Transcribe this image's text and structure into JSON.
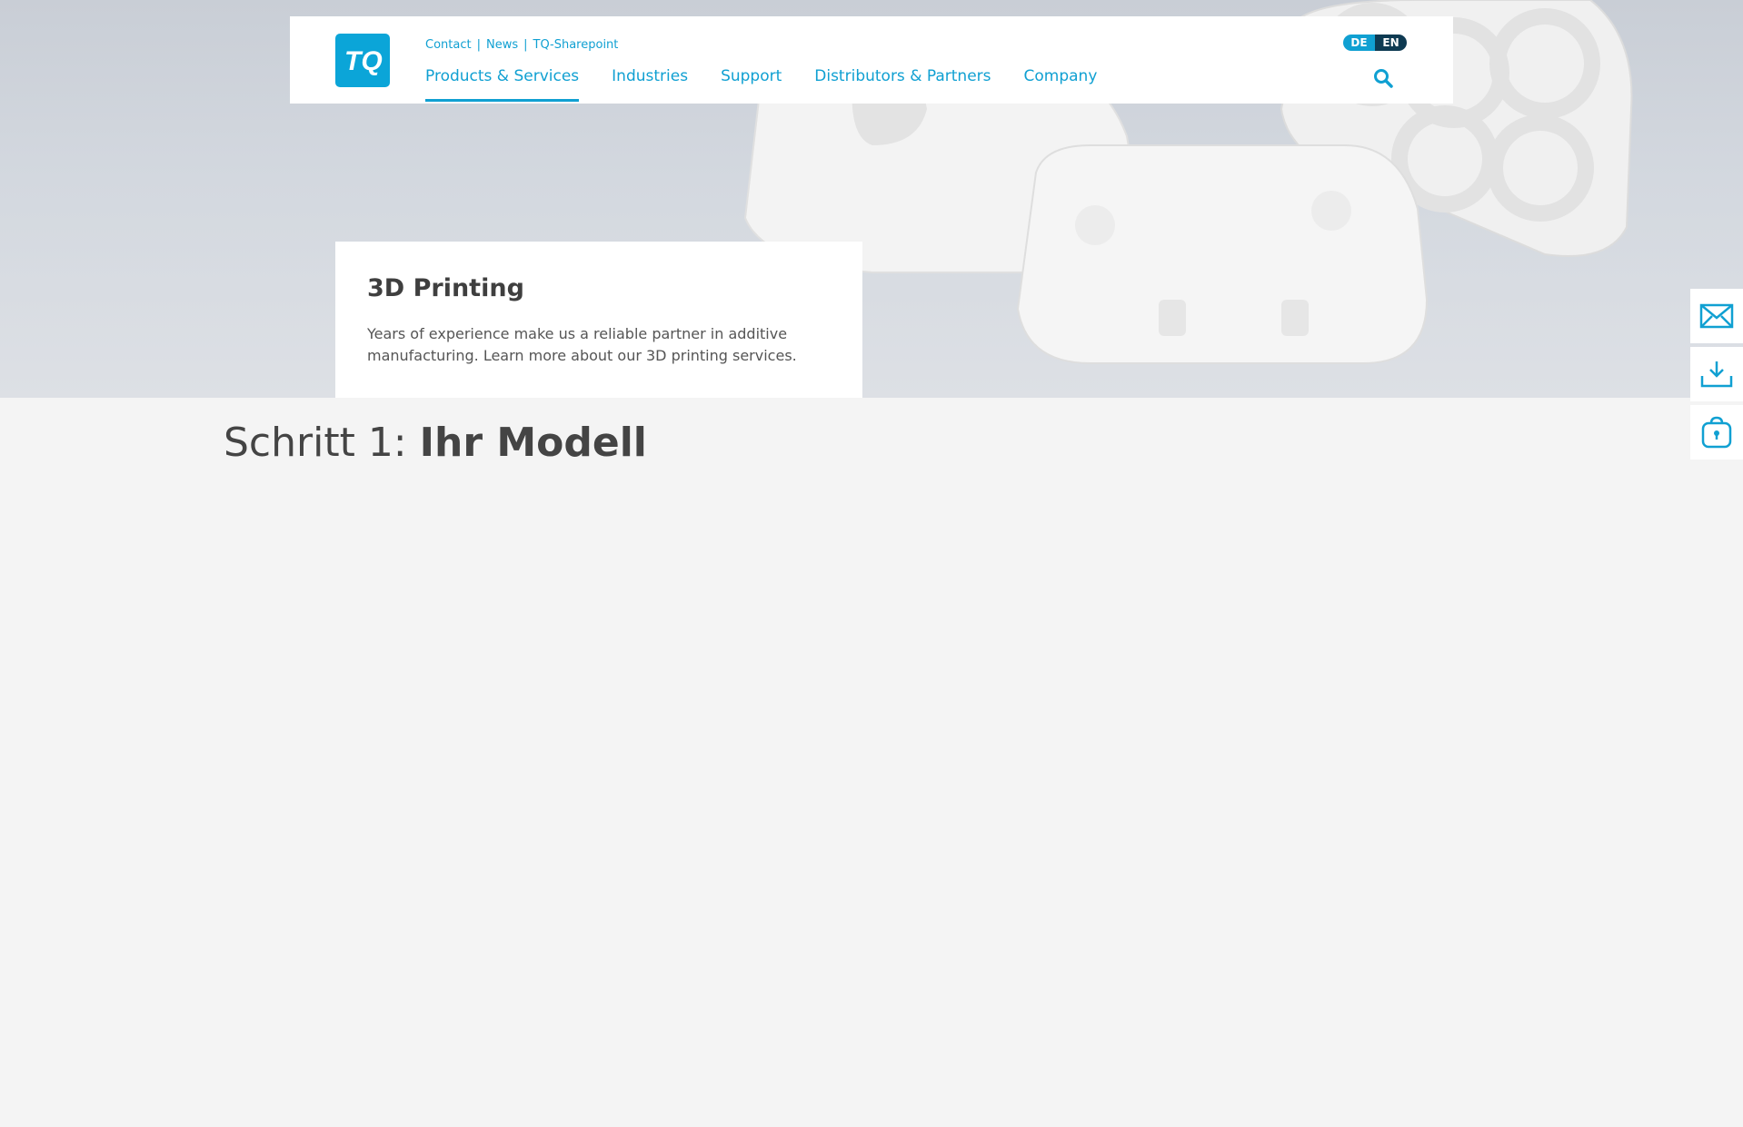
{
  "header": {
    "logo_text": "TQ",
    "meta_nav": [
      "Contact",
      "News",
      "TQ-Sharepoint"
    ],
    "main_nav": [
      {
        "label": "Products & Services",
        "active": true
      },
      {
        "label": "Industries",
        "active": false
      },
      {
        "label": "Support",
        "active": false
      },
      {
        "label": "Distributors & Partners",
        "active": false
      },
      {
        "label": "Company",
        "active": false
      }
    ],
    "lang": {
      "de": "DE",
      "en": "EN"
    },
    "icons": {
      "search": "search-icon"
    }
  },
  "intro": {
    "title": "3D Printing",
    "text": "Years of experience make us a reliable partner in additive manufacturing. Learn more about our 3D printing services."
  },
  "step": {
    "prefix": "Schritt 1: ",
    "title": "Ihr Modell"
  },
  "side_buttons": [
    "mail-icon",
    "download-icon",
    "bag-icon"
  ],
  "colors": {
    "accent": "#10a0d2",
    "dark": "#0e3a52",
    "page_bg": "#f4f4f4"
  }
}
